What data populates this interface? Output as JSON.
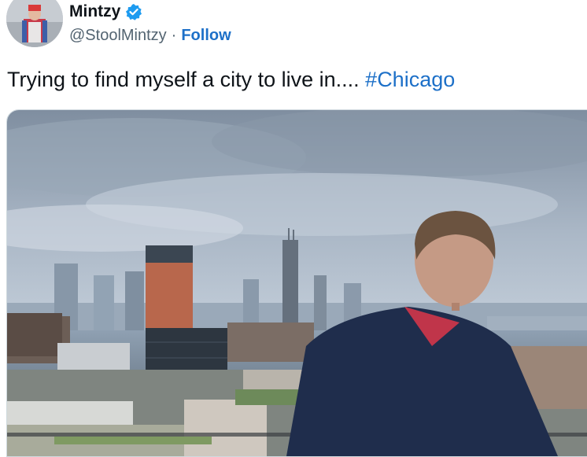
{
  "author": {
    "display_name": "Mintzy",
    "handle": "@StoolMintzy",
    "separator": "·",
    "follow_label": "Follow",
    "verified": true
  },
  "tweet": {
    "text": "Trying to find myself a city to live in....",
    "hashtag": "#Chicago"
  },
  "colors": {
    "link": "#1d70c8",
    "text": "#0f1419",
    "muted": "#536471",
    "verified_badge": "#1d9bf0"
  },
  "icons": [
    "verified-badge-icon"
  ]
}
